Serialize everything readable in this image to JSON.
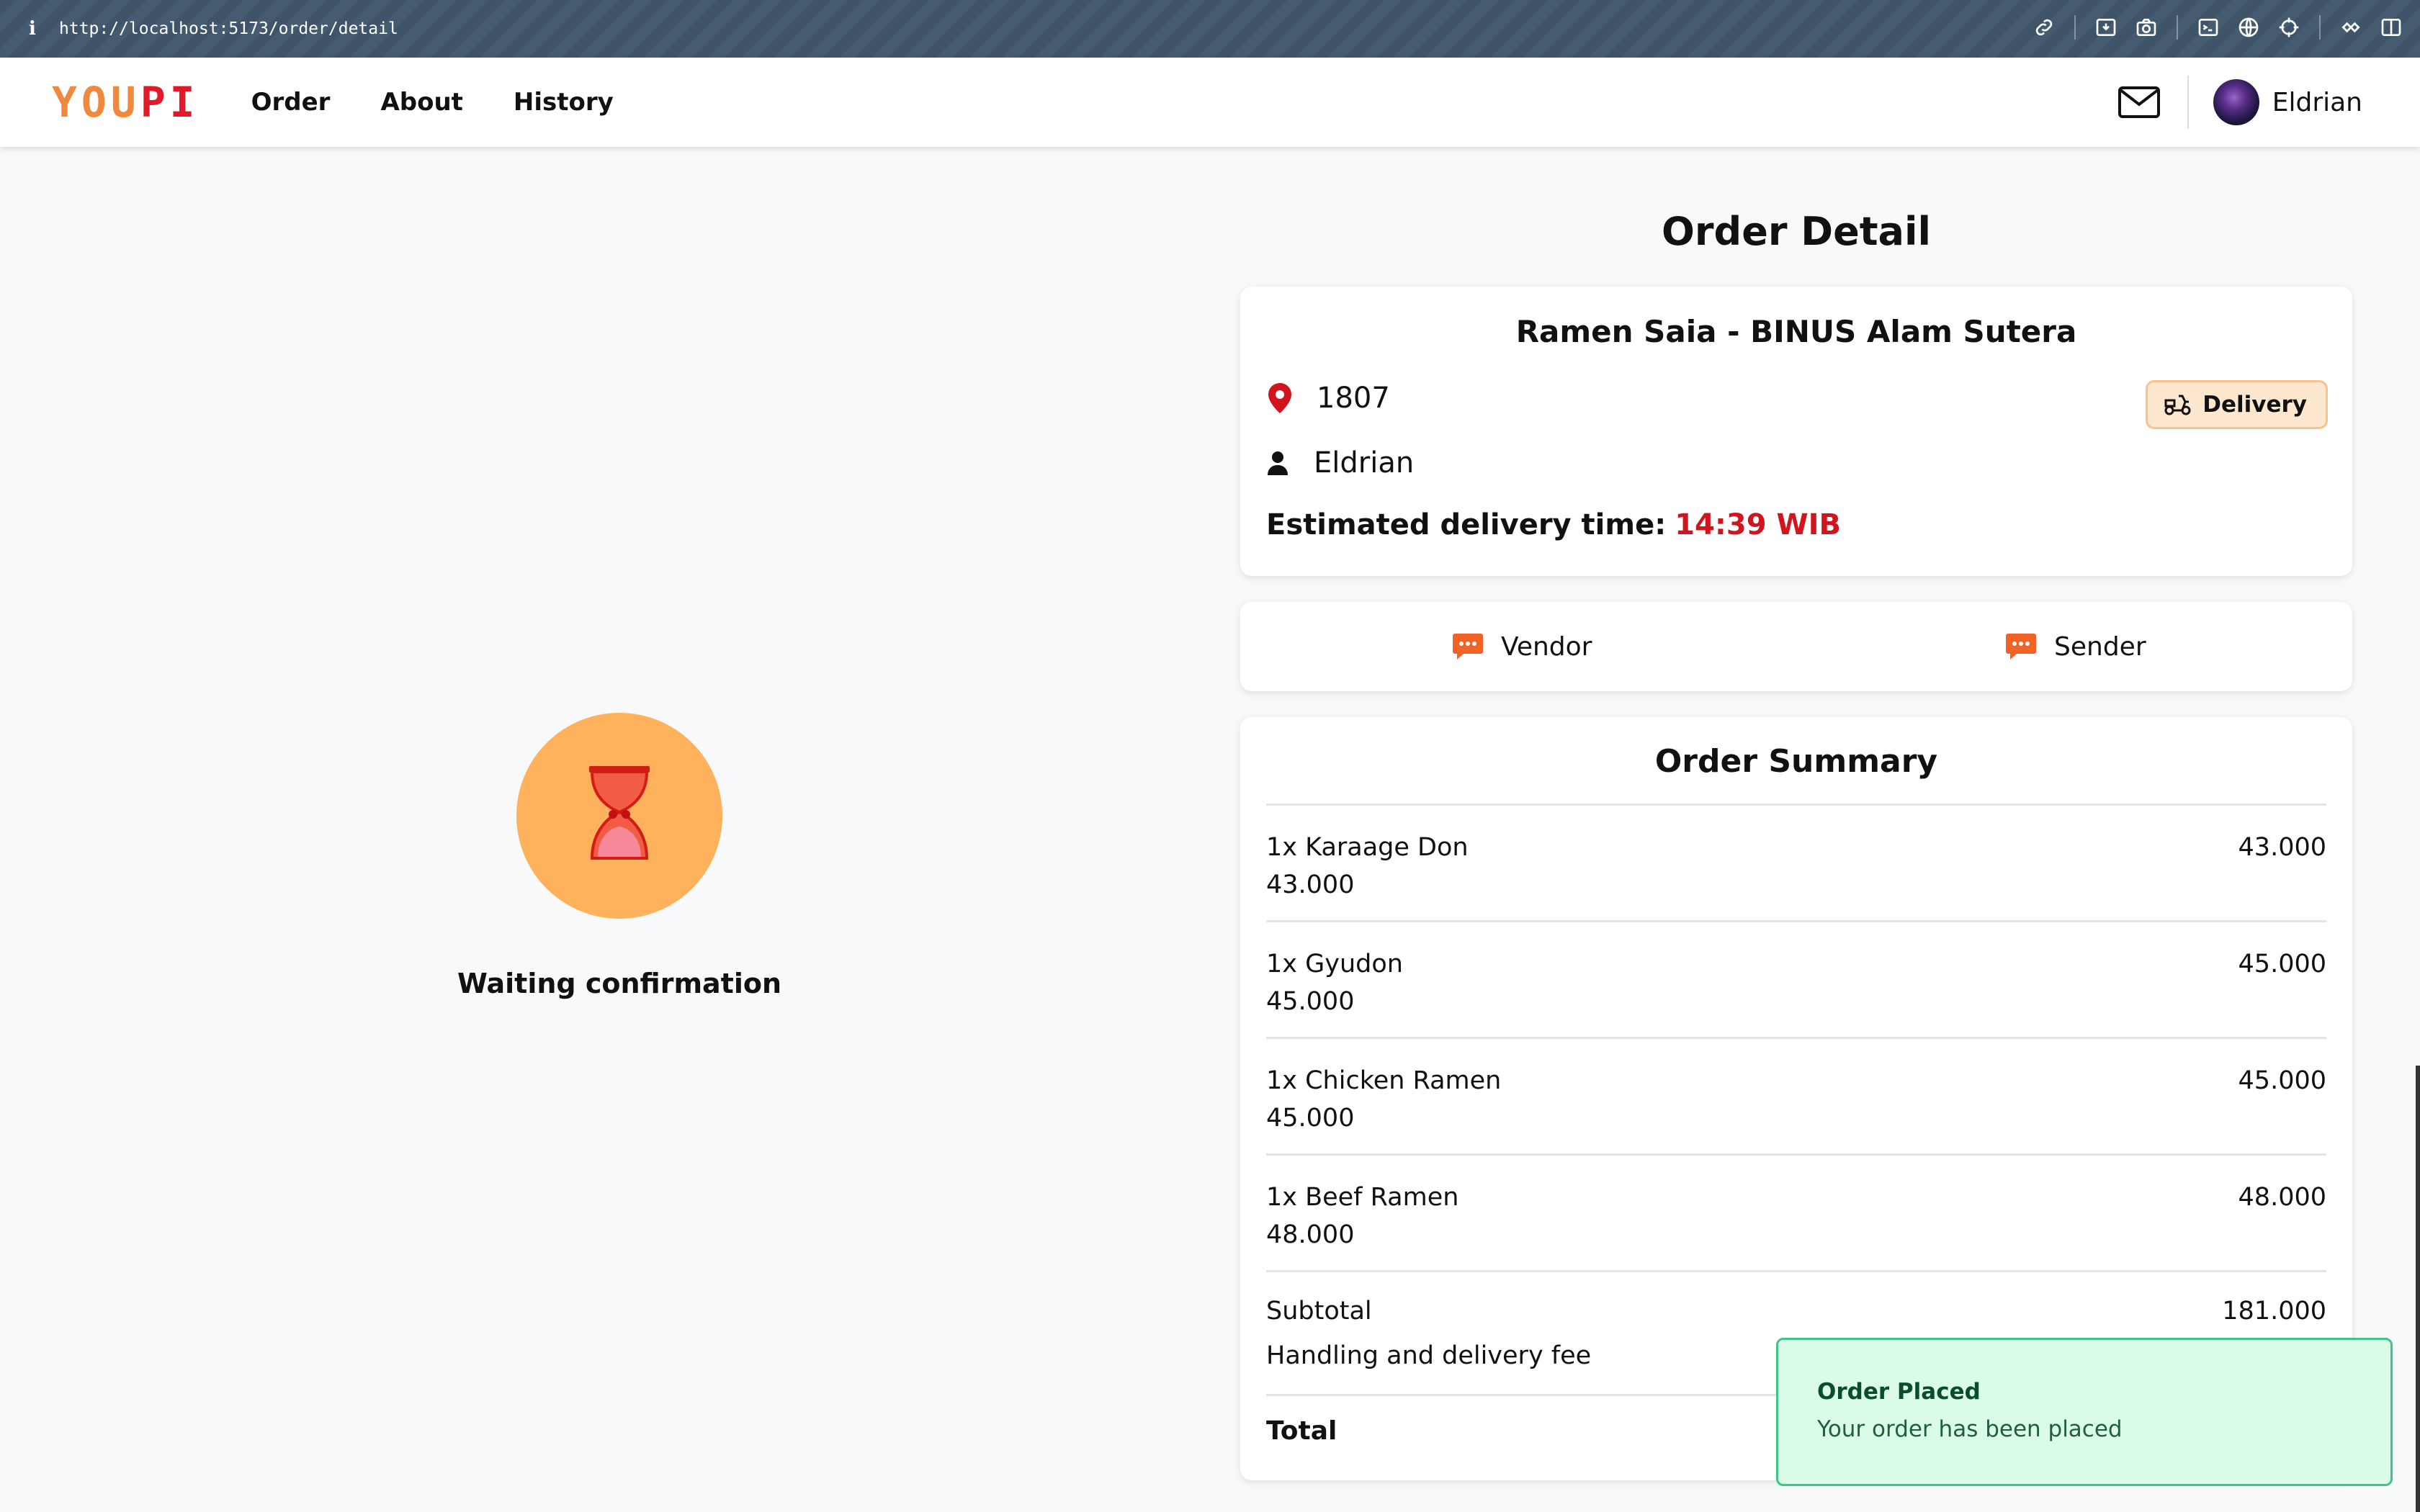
{
  "browser": {
    "info_icon": "i",
    "url": "http://localhost:5173/order/detail"
  },
  "navbar": {
    "logo_part1": "YOU",
    "logo_part2": "PI",
    "links": [
      "Order",
      "About",
      "History"
    ],
    "user_name": "Eldrian"
  },
  "status": {
    "text": "Waiting confirmation",
    "icon": "hourglass-icon",
    "circle_color": "#ffb25b"
  },
  "order_detail": {
    "title": "Order Detail",
    "vendor_name": "Ramen Saia - BINUS Alam Sutera",
    "location": "1807",
    "customer": "Eldrian",
    "eta_label": "Estimated delivery time:",
    "eta_value": "14:39 WIB",
    "badge_label": "Delivery"
  },
  "chat": {
    "vendor_label": "Vendor",
    "sender_label": "Sender"
  },
  "summary": {
    "title": "Order Summary",
    "items": [
      {
        "name": "1x Karaage Don",
        "unit_price": "43.000",
        "price": "43.000"
      },
      {
        "name": "1x Gyudon",
        "unit_price": "45.000",
        "price": "45.000"
      },
      {
        "name": "1x Chicken Ramen",
        "unit_price": "45.000",
        "price": "45.000"
      },
      {
        "name": "1x Beef Ramen",
        "unit_price": "48.000",
        "price": "48.000"
      }
    ],
    "subtotal_label": "Subtotal",
    "subtotal_value": "181.000",
    "fee_label": "Handling and delivery fee",
    "total_label": "Total"
  },
  "toast": {
    "title": "Order Placed",
    "message": "Your order has been placed"
  },
  "colors": {
    "accent_red": "#d0151f",
    "logo_orange": "#f0883e",
    "chat_orange": "#f06226",
    "toast_bg": "#d9fbe8"
  }
}
